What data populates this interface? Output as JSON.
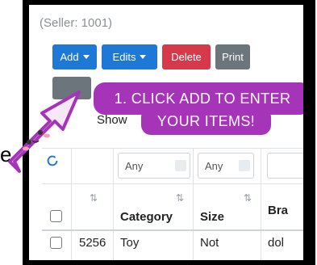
{
  "header": {
    "seller_text": "(Seller: 1001)"
  },
  "toolbar": {
    "add_label": "Add",
    "edits_label": "Edits",
    "delete_label": "Delete",
    "print_label": "Print"
  },
  "show_label": "Show",
  "callout": {
    "line1": "1. CLICK ADD TO ENTER",
    "line2": "YOUR ITEMS!"
  },
  "filters": {
    "category": "Any",
    "size": "Any"
  },
  "table": {
    "headers": {
      "category": "Category",
      "size": "Size",
      "brand": "Bra"
    },
    "rows": [
      {
        "id": "5256",
        "category": "Toy",
        "size": "Not",
        "brand": "dol"
      }
    ]
  },
  "overlay_letter": "e",
  "colors": {
    "primary": "#1d78d6",
    "danger": "#d63a4a",
    "secondary": "#6d757c",
    "callout": "#a634b8"
  }
}
